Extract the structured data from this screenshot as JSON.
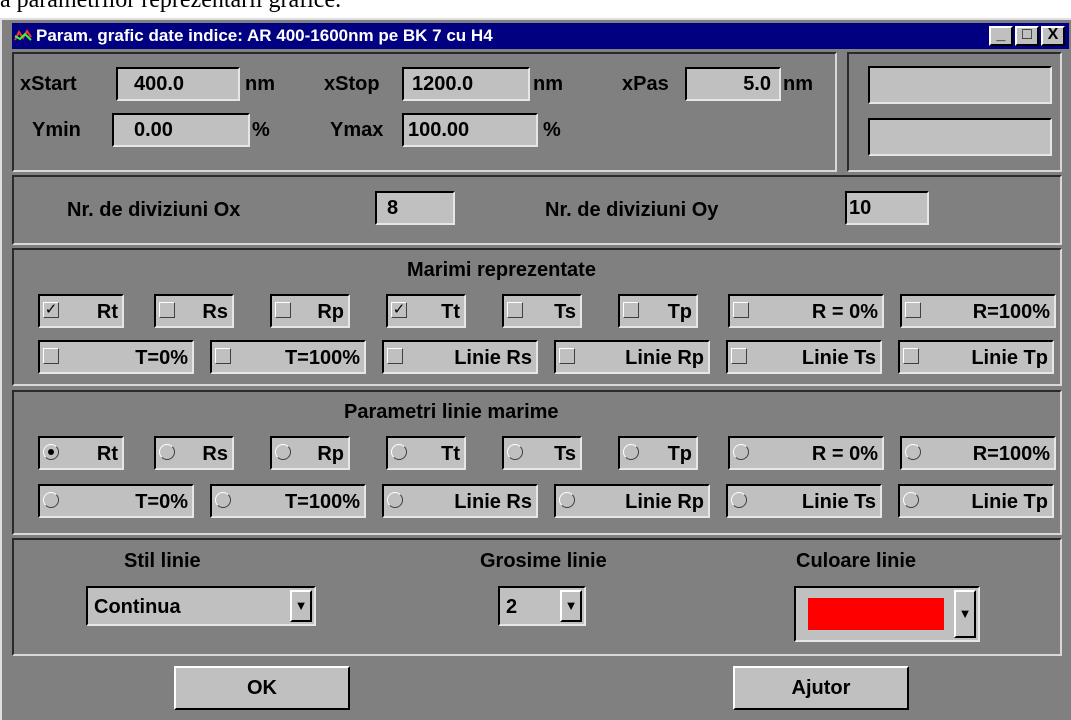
{
  "document_text": "a parametrilor reprezentarii grafice.",
  "window": {
    "title": "Param. grafic date indice: AR 400-1600nm pe BK 7 cu H4",
    "minimize_label": "_",
    "maximize_label": "□",
    "close_label": "X"
  },
  "range": {
    "xstart_label": "xStart",
    "xstart_value": "400.0",
    "xstart_unit": "nm",
    "xstop_label": "xStop",
    "xstop_value": "1200.0",
    "xstop_unit": "nm",
    "xpas_label": "xPas",
    "xpas_value": "5.0",
    "xpas_unit": "nm",
    "ymin_label": "Ymin",
    "ymin_value": "0.00",
    "ymin_unit": "%",
    "ymax_label": "Ymax",
    "ymax_value": "100.00",
    "ymax_unit": "%",
    "aux_field_1": "",
    "aux_field_2": ""
  },
  "divisions": {
    "ox_label": "Nr. de diviziuni Ox",
    "ox_value": "8",
    "oy_label": "Nr. de diviziuni Oy",
    "oy_value": "10"
  },
  "quantities": {
    "title": "Marimi reprezentate",
    "items": [
      {
        "label": "Rt",
        "checked": true
      },
      {
        "label": "Rs",
        "checked": false
      },
      {
        "label": "Rp",
        "checked": false
      },
      {
        "label": "Tt",
        "checked": true
      },
      {
        "label": "Ts",
        "checked": false
      },
      {
        "label": "Tp",
        "checked": false
      },
      {
        "label": "R = 0%",
        "checked": false
      },
      {
        "label": "R=100%",
        "checked": false
      },
      {
        "label": "T=0%",
        "checked": false
      },
      {
        "label": "T=100%",
        "checked": false
      },
      {
        "label": "Linie Rs",
        "checked": false
      },
      {
        "label": "Linie Rp",
        "checked": false
      },
      {
        "label": "Linie Ts",
        "checked": false
      },
      {
        "label": "Linie Tp",
        "checked": false
      }
    ]
  },
  "line_params": {
    "title": "Parametri linie marime",
    "items": [
      {
        "label": "Rt",
        "selected": true
      },
      {
        "label": "Rs",
        "selected": false
      },
      {
        "label": "Rp",
        "selected": false
      },
      {
        "label": "Tt",
        "selected": false
      },
      {
        "label": "Ts",
        "selected": false
      },
      {
        "label": "Tp",
        "selected": false
      },
      {
        "label": "R = 0%",
        "selected": false
      },
      {
        "label": "R=100%",
        "selected": false
      },
      {
        "label": "T=0%",
        "selected": false
      },
      {
        "label": "T=100%",
        "selected": false
      },
      {
        "label": "Linie Rs",
        "selected": false
      },
      {
        "label": "Linie Rp",
        "selected": false
      },
      {
        "label": "Linie Ts",
        "selected": false
      },
      {
        "label": "Linie Tp",
        "selected": false
      }
    ]
  },
  "style": {
    "style_label": "Stil linie",
    "style_value": "Continua",
    "width_label": "Grosime linie",
    "width_value": "2",
    "color_label": "Culoare linie",
    "color_value": "#ff0000"
  },
  "buttons": {
    "ok": "OK",
    "help": "Ajutor"
  },
  "colors": {
    "title_bar": "#000080",
    "dialog_bg": "#808080",
    "control_bg": "#c0c0c0"
  }
}
